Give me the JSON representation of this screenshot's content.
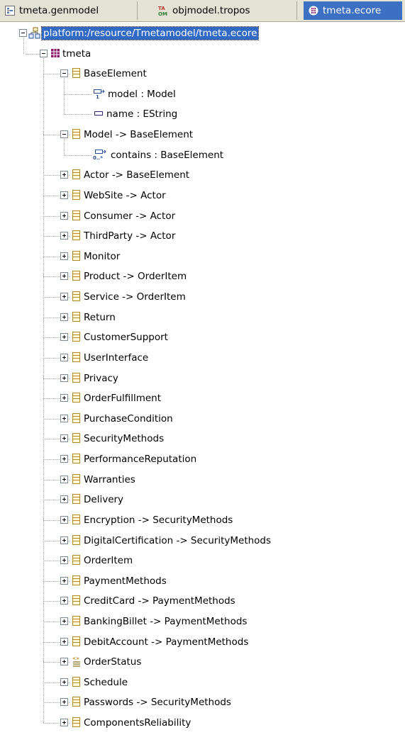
{
  "tabs": [
    {
      "label": "tmeta.genmodel",
      "icon": "genmodel-icon",
      "active": false
    },
    {
      "label": "objmodel.tropos",
      "icon": "tropos-model-icon",
      "active": false
    },
    {
      "label": "tmeta.ecore",
      "icon": "ecore-file-icon",
      "active": true
    }
  ],
  "tree": {
    "root": {
      "label": "platform:/resource/Tmetamodel/tmeta.ecore",
      "expanded": true,
      "selected": true
    },
    "package": {
      "label": "tmeta",
      "expanded": true
    },
    "items": [
      {
        "label": "BaseElement",
        "kind": "class",
        "expanded": true,
        "children": [
          {
            "label": "model : Model",
            "kind": "reference"
          },
          {
            "label": "name : EString",
            "kind": "attribute"
          }
        ]
      },
      {
        "label": "Model -> BaseElement",
        "kind": "class",
        "expanded": true,
        "children": [
          {
            "label": "contains : BaseElement",
            "kind": "containment"
          }
        ]
      },
      {
        "label": "Actor -> BaseElement",
        "kind": "class",
        "expanded": false
      },
      {
        "label": "WebSite -> Actor",
        "kind": "class",
        "expanded": false
      },
      {
        "label": "Consumer -> Actor",
        "kind": "class",
        "expanded": false
      },
      {
        "label": "ThirdParty -> Actor",
        "kind": "class",
        "expanded": false
      },
      {
        "label": "Monitor",
        "kind": "class",
        "expanded": false
      },
      {
        "label": "Product -> OrderItem",
        "kind": "class",
        "expanded": false
      },
      {
        "label": "Service -> OrderItem",
        "kind": "class",
        "expanded": false
      },
      {
        "label": "Return",
        "kind": "class",
        "expanded": false
      },
      {
        "label": "CustomerSupport",
        "kind": "class",
        "expanded": false
      },
      {
        "label": "UserInterface",
        "kind": "class",
        "expanded": false
      },
      {
        "label": "Privacy",
        "kind": "class",
        "expanded": false
      },
      {
        "label": "OrderFulfillment",
        "kind": "class",
        "expanded": false
      },
      {
        "label": "PurchaseCondition",
        "kind": "class",
        "expanded": false
      },
      {
        "label": "SecurityMethods",
        "kind": "class",
        "expanded": false
      },
      {
        "label": "PerformanceReputation",
        "kind": "class",
        "expanded": false
      },
      {
        "label": "Warranties",
        "kind": "class",
        "expanded": false
      },
      {
        "label": "Delivery",
        "kind": "class",
        "expanded": false
      },
      {
        "label": "Encryption -> SecurityMethods",
        "kind": "class",
        "expanded": false
      },
      {
        "label": "DigitalCertification -> SecurityMethods",
        "kind": "class",
        "expanded": false
      },
      {
        "label": "OrderItem",
        "kind": "class",
        "expanded": false
      },
      {
        "label": "PaymentMethods",
        "kind": "class",
        "expanded": false
      },
      {
        "label": "CreditCard -> PaymentMethods",
        "kind": "class",
        "expanded": false
      },
      {
        "label": "BankingBillet -> PaymentMethods",
        "kind": "class",
        "expanded": false
      },
      {
        "label": "DebitAccount -> PaymentMethods",
        "kind": "class",
        "expanded": false
      },
      {
        "label": "OrderStatus",
        "kind": "enum",
        "expanded": false
      },
      {
        "label": "Schedule",
        "kind": "class",
        "expanded": false
      },
      {
        "label": "Passwords -> SecurityMethods",
        "kind": "class",
        "expanded": false
      },
      {
        "label": "ComponentsReliability",
        "kind": "class",
        "expanded": false
      }
    ]
  },
  "colors": {
    "selection": "#316ac5",
    "active_tab": "#3d6fc2",
    "tab_bar": "#e4e2d5",
    "class_icon_border": "#b08a25",
    "package_icon": "#8b1a6b"
  }
}
